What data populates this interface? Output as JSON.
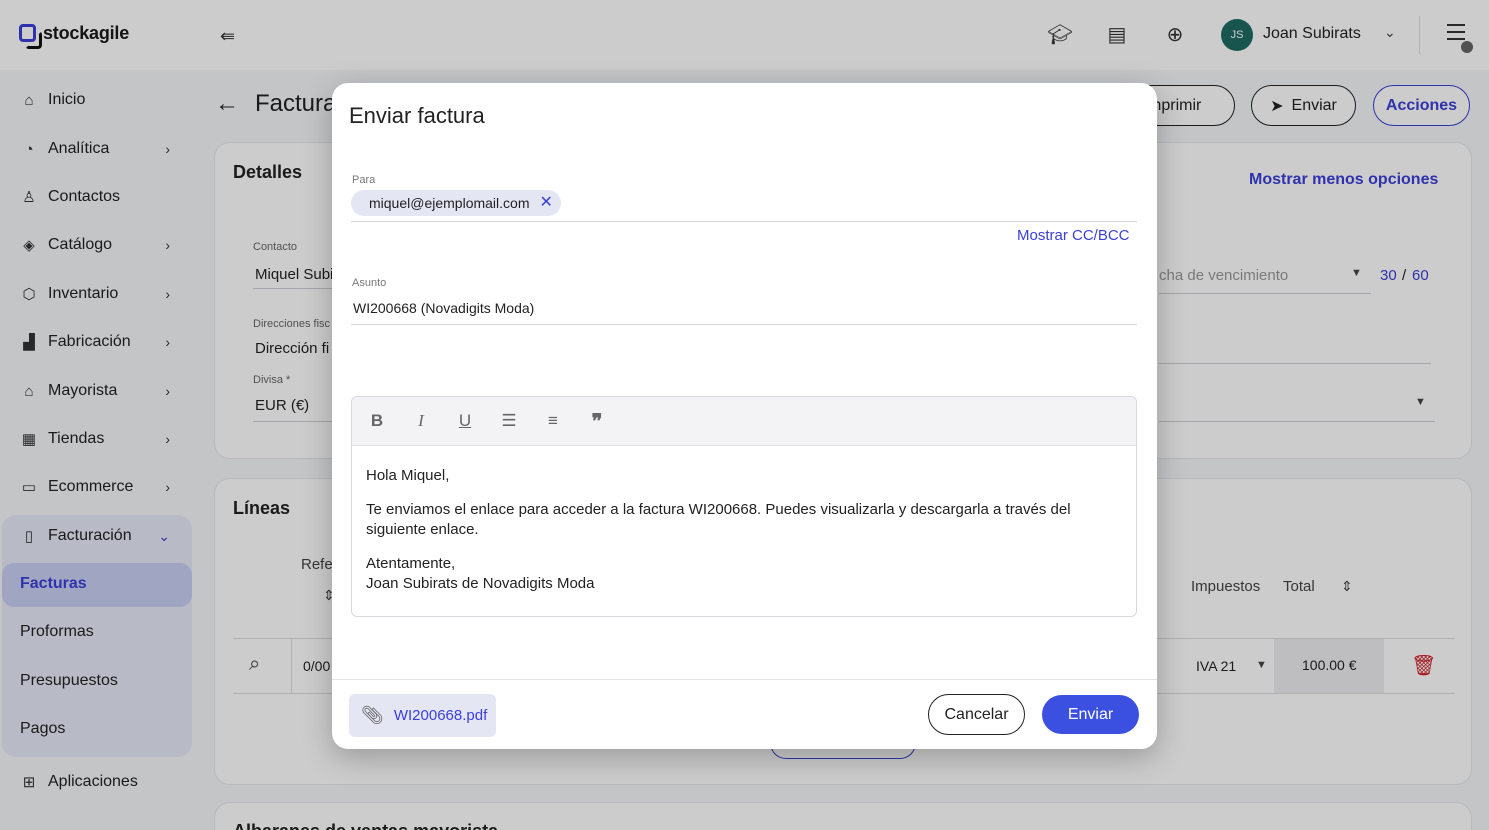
{
  "app": {
    "name": "stockagile"
  },
  "header": {
    "user_initials": "JS",
    "user_name": "Joan Subirats"
  },
  "sidebar": {
    "items": [
      {
        "label": "Inicio",
        "icon": "home-icon"
      },
      {
        "label": "Analítica",
        "icon": "chart-icon"
      },
      {
        "label": "Contactos",
        "icon": "user-icon"
      },
      {
        "label": "Catálogo",
        "icon": "tag-icon"
      },
      {
        "label": "Inventario",
        "icon": "box-icon"
      },
      {
        "label": "Fabricación",
        "icon": "factory-icon"
      },
      {
        "label": "Mayorista",
        "icon": "warehouse-icon"
      },
      {
        "label": "Tiendas",
        "icon": "store-icon"
      },
      {
        "label": "Ecommerce",
        "icon": "laptop-icon"
      },
      {
        "label": "Facturación",
        "icon": "document-icon"
      }
    ],
    "billing_sub": [
      "Facturas",
      "Proformas",
      "Presupuestos",
      "Pagos"
    ],
    "apps": "Aplicaciones"
  },
  "page": {
    "title": "Factura",
    "buttons": {
      "print": "Imprimir",
      "send": "Enviar",
      "actions": "Acciones"
    },
    "details": {
      "title": "Detalles",
      "toggle_options": "Mostrar menos opciones",
      "contact_label": "Contacto",
      "contact_value": "Miquel Subi",
      "address_label": "Direcciones fisc",
      "address_value": "Dirección fi",
      "currency_label": "Divisa *",
      "currency_value": "EUR (€)",
      "due_label": "cha de vencimiento",
      "days_a": "30",
      "days_sep": "/",
      "days_b": "60"
    },
    "lines": {
      "title": "Líneas",
      "col_ref": "Refe",
      "col_tax": "Impuestos",
      "col_total": "Total",
      "ref_value": "0/00",
      "tax_value": "IVA 21",
      "total_value": "100.00 €"
    },
    "next_section": "Albaranes de ventas mayorista"
  },
  "modal": {
    "title": "Enviar factura",
    "to_label": "Para",
    "to_email": "miquel@ejemplomail.com",
    "cc_link": "Mostrar CC/BCC",
    "subject_label": "Asunto",
    "subject_value": "WI200668 (Novadigits Moda)",
    "body": {
      "greeting": "Hola Miquel,",
      "message": "Te enviamos el enlace para acceder a la factura WI200668. Puedes visualizarla y descargarla a través del siguiente enlace.",
      "closing": "Atentamente,",
      "signature": "Joan Subirats de Novadigits Moda"
    },
    "attachment": "WI200668.pdf",
    "cancel": "Cancelar",
    "send": "Enviar"
  },
  "colors": {
    "accent": "#3b3fd8",
    "send_button": "#3b4fe0",
    "avatar": "#1f6b63",
    "delete": "#d0202a"
  }
}
